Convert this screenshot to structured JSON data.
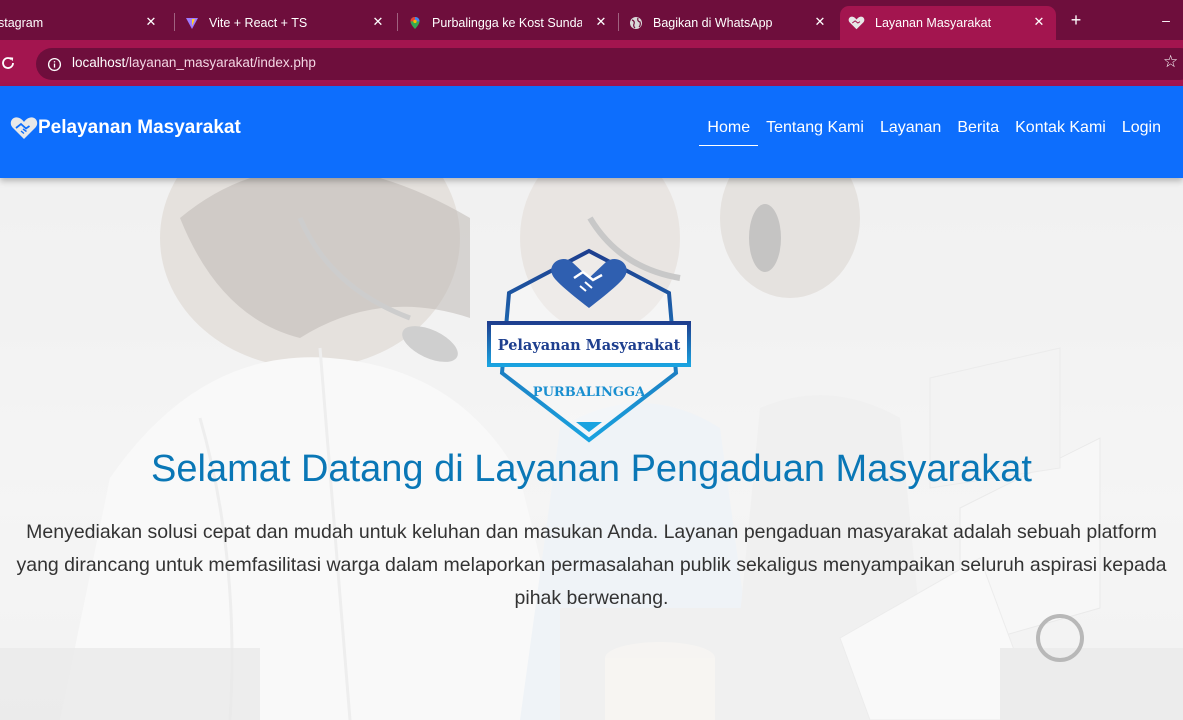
{
  "browser": {
    "tabs": [
      {
        "title": "stagram",
        "favicon": "instagram-icon"
      },
      {
        "title": "Vite + React + TS",
        "favicon": "vite-icon"
      },
      {
        "title": "Purbalingga ke Kost Sundari",
        "favicon": "google-maps-icon"
      },
      {
        "title": "Bagikan di WhatsApp",
        "favicon": "globe-icon"
      },
      {
        "title": "Layanan Masyarakat",
        "favicon": "heart-handshake-icon",
        "active": true
      }
    ],
    "new_tab": "+",
    "minimize": "–",
    "url_host": "localhost",
    "url_path": "/layanan_masyarakat/index.php",
    "accent": "#a3154f"
  },
  "navbar": {
    "brand": "Pelayanan Masyarakat",
    "links": [
      "Home",
      "Tentang Kami",
      "Layanan",
      "Berita",
      "Kontak Kami",
      "Login"
    ],
    "active": "Home",
    "color": "#0d6efd"
  },
  "hero": {
    "logo": {
      "line1": "Pelayanan Masyarakat",
      "line2": "PURBALINGGA"
    },
    "title": "Selamat Datang di Layanan Pengaduan Masyarakat",
    "description": "Menyediakan solusi cepat dan mudah untuk keluhan dan masukan Anda. Layanan pengaduan masyarakat adalah sebuah platform yang dirancang untuk memfasilitasi warga dalam melaporkan permasalahan publik sekaligus menyampaikan seluruh aspirasi kepada pihak berwenang.",
    "title_color": "#0a77b6"
  }
}
